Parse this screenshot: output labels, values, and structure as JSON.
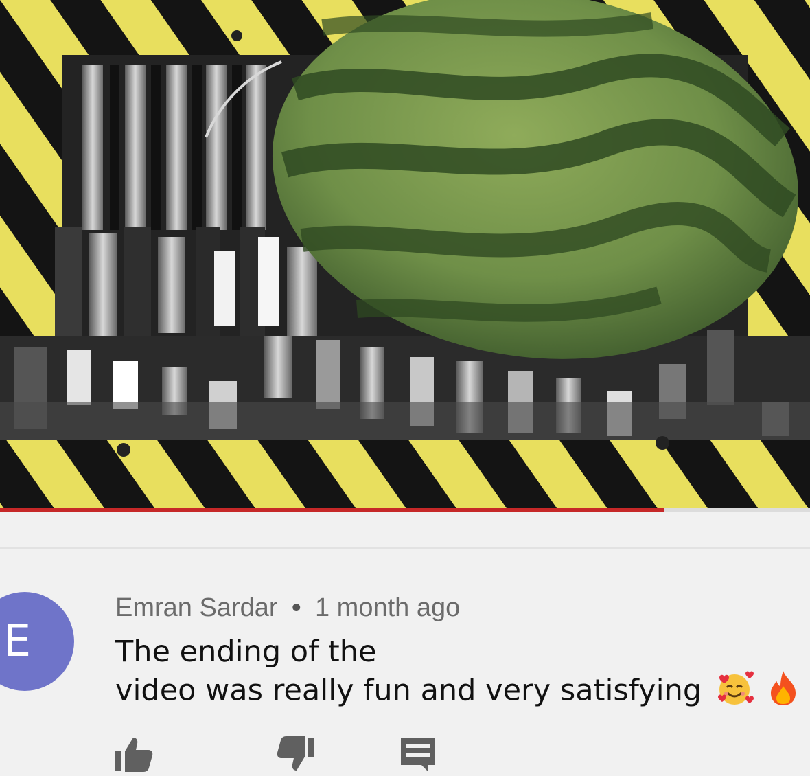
{
  "video": {
    "progress_fraction": 0.82
  },
  "comment": {
    "avatar_letter": "E",
    "avatar_color": "#6f74c9",
    "author": "Emran Sardar",
    "separator": "•",
    "time_ago": "1 month ago",
    "text_line1": "The ending of the",
    "text_line2": "video was really fun and very satisfying",
    "emojis": [
      "smiling-face-with-hearts",
      "fire"
    ]
  },
  "actions": {
    "icons": [
      "thumbs-up-icon",
      "thumbs-down-icon",
      "reply-icon"
    ]
  },
  "colors": {
    "hazard_yellow": "#e8df5e",
    "hazard_black": "#141414",
    "watermelon_green": "#6f8f48",
    "progress_red": "#c62828"
  }
}
